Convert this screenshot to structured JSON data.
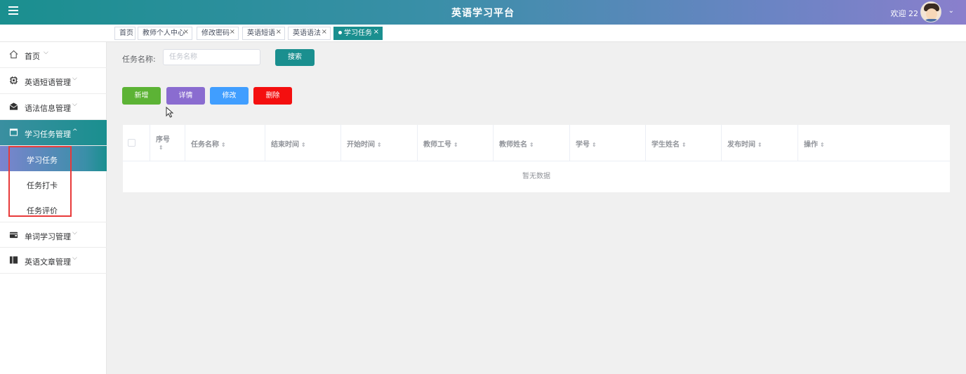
{
  "header": {
    "title": "英语学习平台",
    "welcome": "欢迎 22",
    "caret": "⌄"
  },
  "tabs": [
    {
      "label": "首页",
      "closable": false
    },
    {
      "label": "教师个人中心",
      "closable": true
    },
    {
      "label": "修改密码",
      "closable": true
    },
    {
      "label": "英语短语",
      "closable": true
    },
    {
      "label": "英语语法",
      "closable": true
    },
    {
      "label": "学习任务",
      "closable": true,
      "active": true
    }
  ],
  "tab_close": "×",
  "sidebar": {
    "items": [
      {
        "label": "首页",
        "icon": "home-icon",
        "chevron": "⌵"
      },
      {
        "label": "英语短语管理",
        "icon": "chip-icon",
        "chevron": "⌵"
      },
      {
        "label": "语法信息管理",
        "icon": "envelope-icon",
        "chevron": "⌵"
      },
      {
        "label": "学习任务管理",
        "icon": "window-icon",
        "chevron": "^"
      },
      {
        "label": "单词学习管理",
        "icon": "wallet-icon",
        "chevron": "⌵"
      },
      {
        "label": "英语文章管理",
        "icon": "book-icon",
        "chevron": "⌵"
      }
    ],
    "sub_items": [
      {
        "label": "学习任务",
        "active": true
      },
      {
        "label": "任务打卡",
        "active": false
      },
      {
        "label": "任务评价",
        "active": false
      }
    ]
  },
  "search": {
    "label": "任务名称:",
    "placeholder": "任务名称",
    "value": "",
    "button": "搜索"
  },
  "actions": {
    "add": "新增",
    "detail": "详情",
    "edit": "修改",
    "delete": "删除"
  },
  "table": {
    "columns": [
      "序号",
      "任务名称",
      "结束时间",
      "开始时间",
      "教师工号",
      "教师姓名",
      "学号",
      "学生姓名",
      "发布时间",
      "操作"
    ],
    "sort_glyph": "⇕",
    "rows": [],
    "empty_text": "暂无数据"
  },
  "colors": {
    "primary": "#1a8f8f",
    "header_end": "#8a7fcc",
    "add": "#5cb335",
    "detail": "#8a6cd0",
    "edit": "#409eff",
    "delete": "#f40f0f",
    "highlight": "#e83a3a"
  }
}
